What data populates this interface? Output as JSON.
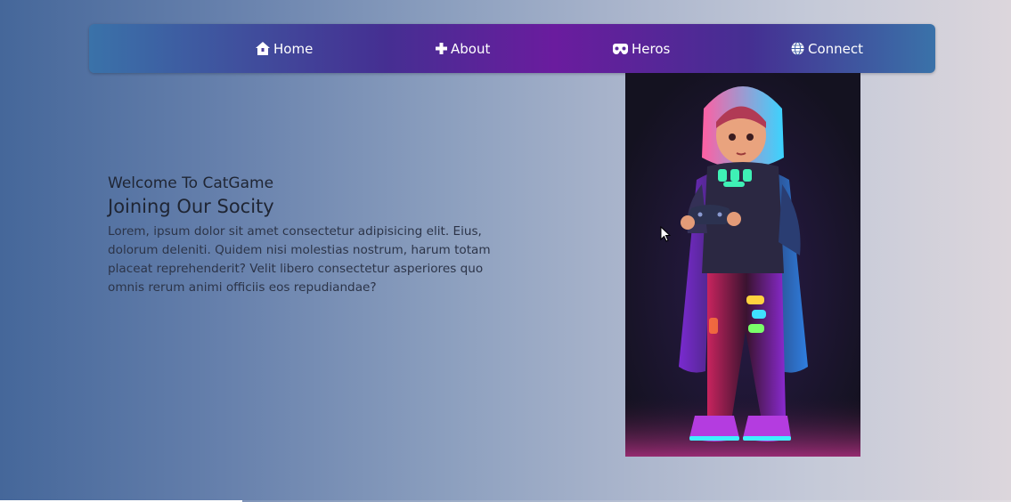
{
  "nav": {
    "items": [
      {
        "label": "Home",
        "icon": "home-icon"
      },
      {
        "label": "About",
        "icon": "plus-icon"
      },
      {
        "label": "Heros",
        "icon": "gamepad-mask-icon"
      },
      {
        "label": "Connect",
        "icon": "globe-icon"
      }
    ]
  },
  "hero": {
    "welcome": "Welcome To CatGame",
    "heading": "Joining Our Socity",
    "paragraph": "Lorem, ipsum dolor sit amet consectetur adipisicing elit. Eius, dolorum deleniti. Quidem nisi molestias nostrum, harum totam placeat reprehenderit? Velit libero consectetur asperiores quo omnis rerum animi officiis eos repudiandae?"
  },
  "image": {
    "subject": "neon hooded gamer girl holding controller"
  },
  "playback": {
    "progress": 0.24
  },
  "colors": {
    "nav_start": "#3a72a9",
    "nav_mid": "#6a1c9e",
    "text": "#1f2533"
  }
}
